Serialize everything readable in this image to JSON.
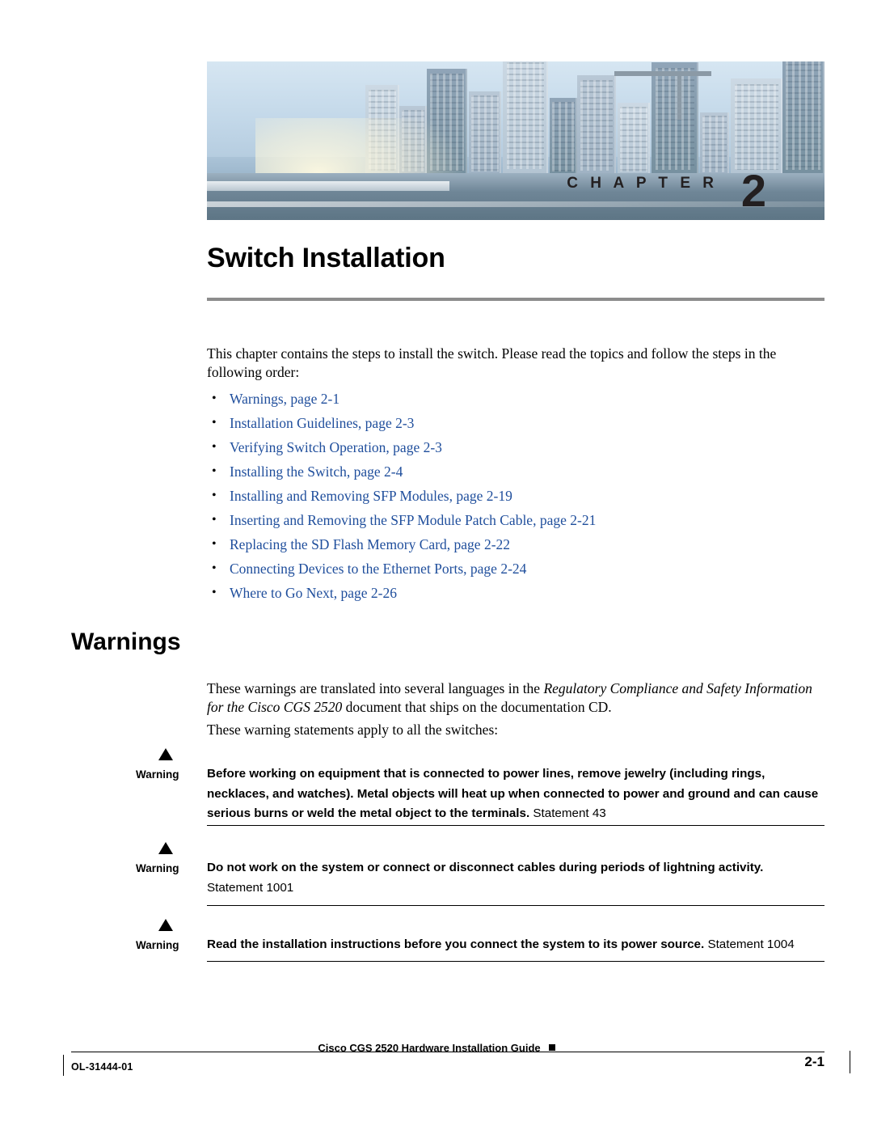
{
  "banner": {
    "chapter_label": "C H A P T E R",
    "chapter_number": "2",
    "image_name": "city-skyline-photo"
  },
  "chapter_title": "Switch Installation",
  "intro_paragraph": "This chapter contains the steps to install the switch. Please read the topics and follow the steps in the following order:",
  "toc_links": [
    "Warnings, page 2-1",
    "Installation Guidelines, page 2-3",
    "Verifying Switch Operation, page 2-3",
    "Installing the Switch, page 2-4",
    "Installing and Removing SFP Modules, page 2-19",
    "Inserting and Removing the SFP Module Patch Cable, page 2-21",
    "Replacing the SD Flash Memory Card, page 2-22",
    "Connecting Devices to the Ethernet Ports, page 2-24",
    "Where to Go Next, page 2-26"
  ],
  "section": {
    "heading": "Warnings",
    "paragraph_1_before": "These warnings are translated into several languages in the ",
    "paragraph_1_italic": "Regulatory Compliance and Safety Information for the Cisco CGS 2520",
    "paragraph_1_after": " document that ships on the documentation CD.",
    "paragraph_2": "These warning statements apply to all the switches:"
  },
  "warnings": [
    {
      "label": "Warning",
      "bold_text": "Before working on equipment that is connected to power lines, remove jewelry (including rings, necklaces, and watches). Metal objects will heat up when connected to power and ground and can cause serious burns or weld the metal object to the terminals.",
      "statement": " Statement 43"
    },
    {
      "label": "Warning",
      "bold_text": "Do not work on the system or connect or disconnect cables during periods of lightning activity.",
      "statement": "Statement 1001"
    },
    {
      "label": "Warning",
      "bold_text": "Read the installation instructions before you connect the system to its power source.",
      "statement": " Statement 1004"
    }
  ],
  "footer": {
    "doc_number": "OL-31444-01",
    "doc_title": "Cisco CGS 2520 Hardware Installation Guide",
    "page_number": "2-1"
  },
  "colors": {
    "link": "#1f4e9c",
    "rule": "#8c8c8c"
  }
}
